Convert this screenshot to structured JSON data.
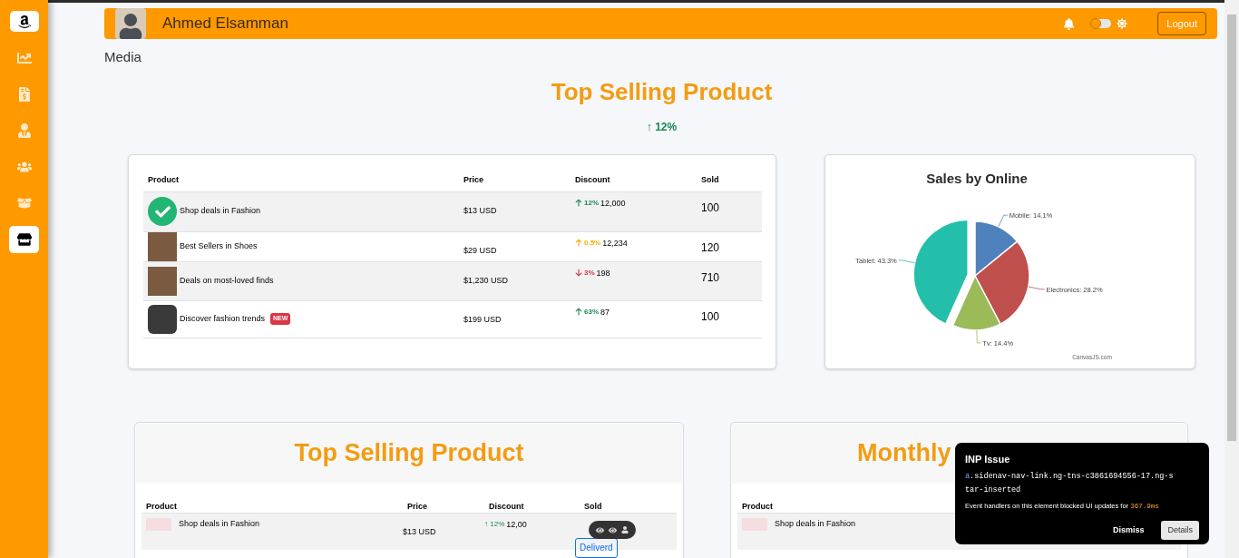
{
  "sidebar": {
    "items": [
      {
        "kind": "chart",
        "selected": false
      },
      {
        "kind": "invoice",
        "selected": false
      },
      {
        "kind": "user",
        "selected": false
      },
      {
        "kind": "users",
        "selected": false
      },
      {
        "kind": "box",
        "selected": false
      },
      {
        "kind": "store",
        "selected": true
      }
    ]
  },
  "header": {
    "user_name": "Ahmed Elsamman",
    "theme_toggle": {
      "on": false
    },
    "logout": "Logout"
  },
  "breadcrumb": "Media",
  "top_selling": {
    "title": "Top Selling Product",
    "change": {
      "arrow": "↑",
      "text": "12%"
    },
    "table": {
      "columns": [
        "Product",
        "Price",
        "Discount",
        "Sold"
      ],
      "rows": [
        {
          "kind": "check",
          "product": "Shop deals in Fashion",
          "badge": "",
          "price": "$13 USD",
          "discount": {
            "kind": "up",
            "percent": "12%",
            "amount": "12,000"
          },
          "sold": "100"
        },
        {
          "kind": "photo",
          "product": "Best Sellers in Shoes",
          "badge": "",
          "price": "$29 USD",
          "discount": {
            "kind": "slight_up",
            "percent": "0.5%",
            "amount": "12,234"
          },
          "sold": "120"
        },
        {
          "kind": "photo",
          "product": "Deals on most-loved finds",
          "badge": "",
          "price": "$1,230 USD",
          "discount": {
            "kind": "down",
            "percent": "3%",
            "amount": "198"
          },
          "sold": "710"
        },
        {
          "kind": "shoe",
          "product": "Discover fashion trends",
          "badge": "NEW",
          "price": "$199 USD",
          "discount": {
            "kind": "up",
            "percent": "63%",
            "amount": "87"
          },
          "sold": "100"
        }
      ]
    }
  },
  "sales_chart": {
    "chart_data": {
      "type": "pie",
      "title": "Sales by Online",
      "values": [
        14.1,
        28.2,
        14.4,
        43.3
      ],
      "value_labels": [
        "Mobile: 14.1%",
        "Electronics: 28.2%",
        "Tv: 14.4%",
        "Tablet: 43.3%"
      ]
    },
    "credit": "CanvasJS.com"
  },
  "bottom_cards": [
    {
      "title": "Top Selling Product",
      "columns": [
        "Product",
        "Price",
        "Discount",
        "Sold"
      ],
      "row": {
        "product": "Shop deals in Fashion",
        "price": "$13 USD",
        "arrow": "↑",
        "percent": "12%",
        "amount": "12,00",
        "status": "Deliverd"
      }
    },
    {
      "title": "Monthly",
      "columns": [
        "Product"
      ],
      "row": {
        "product": "Shop deals in Fashion"
      }
    }
  ],
  "inp_popup": {
    "title": "INP Issue",
    "selector_tag": "a",
    "selector_rest": ".sidenav-nav-link.ng-tns-c3861694556-17.ng-star-inserted",
    "message": "Event handlers on this element blocked UI updates for ",
    "duration": "367.9ms",
    "buttons": [
      "Dismiss",
      "Details"
    ]
  }
}
